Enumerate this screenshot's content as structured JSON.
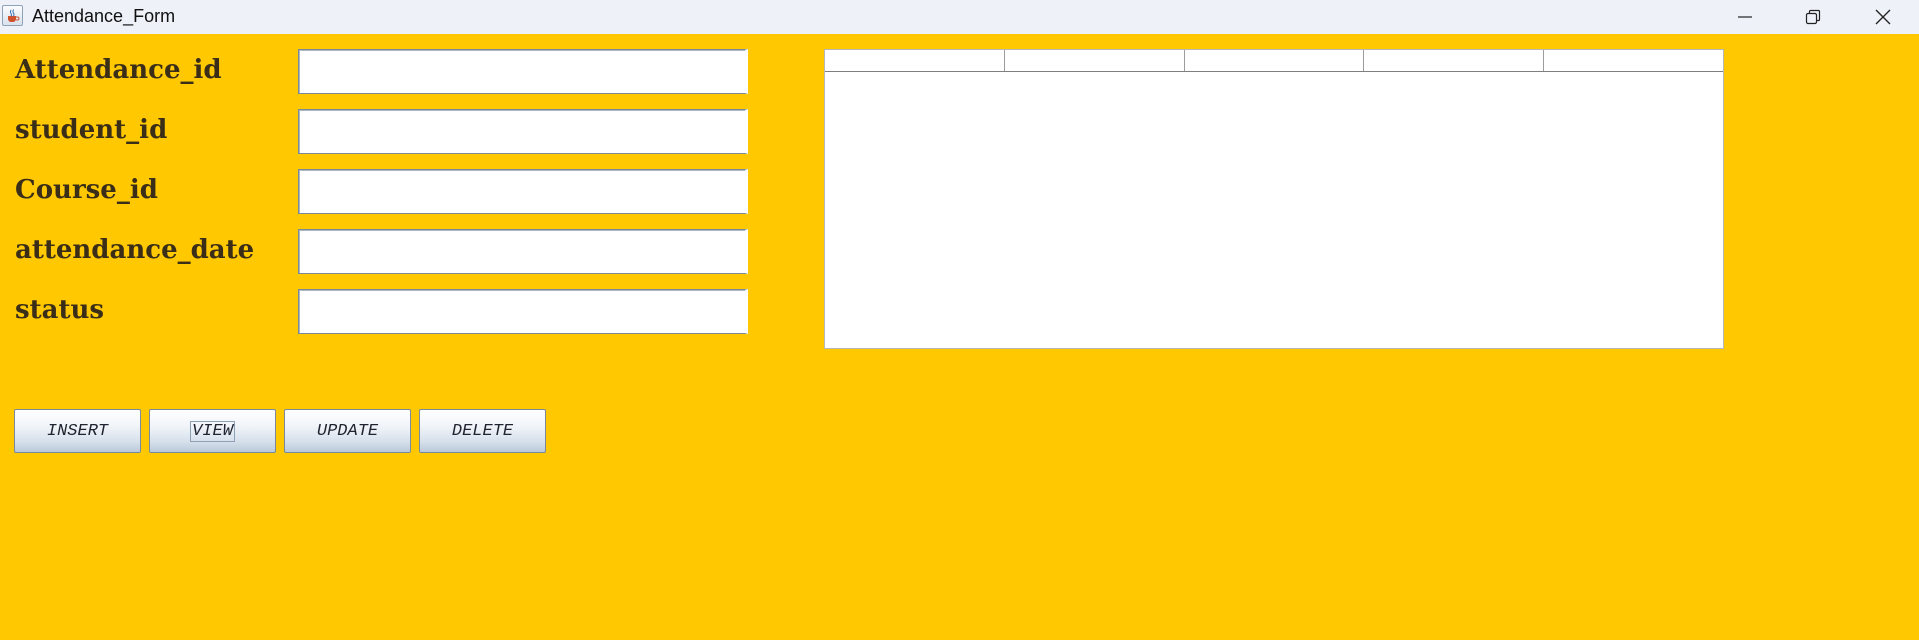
{
  "window": {
    "title": "Attendance_Form",
    "app_icon": "java-cup-icon",
    "controls": [
      "minimize-icon",
      "restore-icon",
      "close-icon"
    ]
  },
  "form": {
    "fields": [
      {
        "label": "Attendance_id",
        "value": ""
      },
      {
        "label": "student_id",
        "value": ""
      },
      {
        "label": "Course_id",
        "value": ""
      },
      {
        "label": "attendance_date",
        "value": ""
      },
      {
        "label": "status",
        "value": ""
      }
    ]
  },
  "buttons": {
    "insert": "INSERT",
    "view": "VIEW",
    "update": "UPDATE",
    "delete": "DELETE"
  },
  "table": {
    "columns": [
      "",
      "",
      "",
      "",
      ""
    ],
    "rows": []
  },
  "colors": {
    "background": "#ffc800",
    "label_text": "#3a2e18",
    "titlebar": "#eef1f8"
  }
}
